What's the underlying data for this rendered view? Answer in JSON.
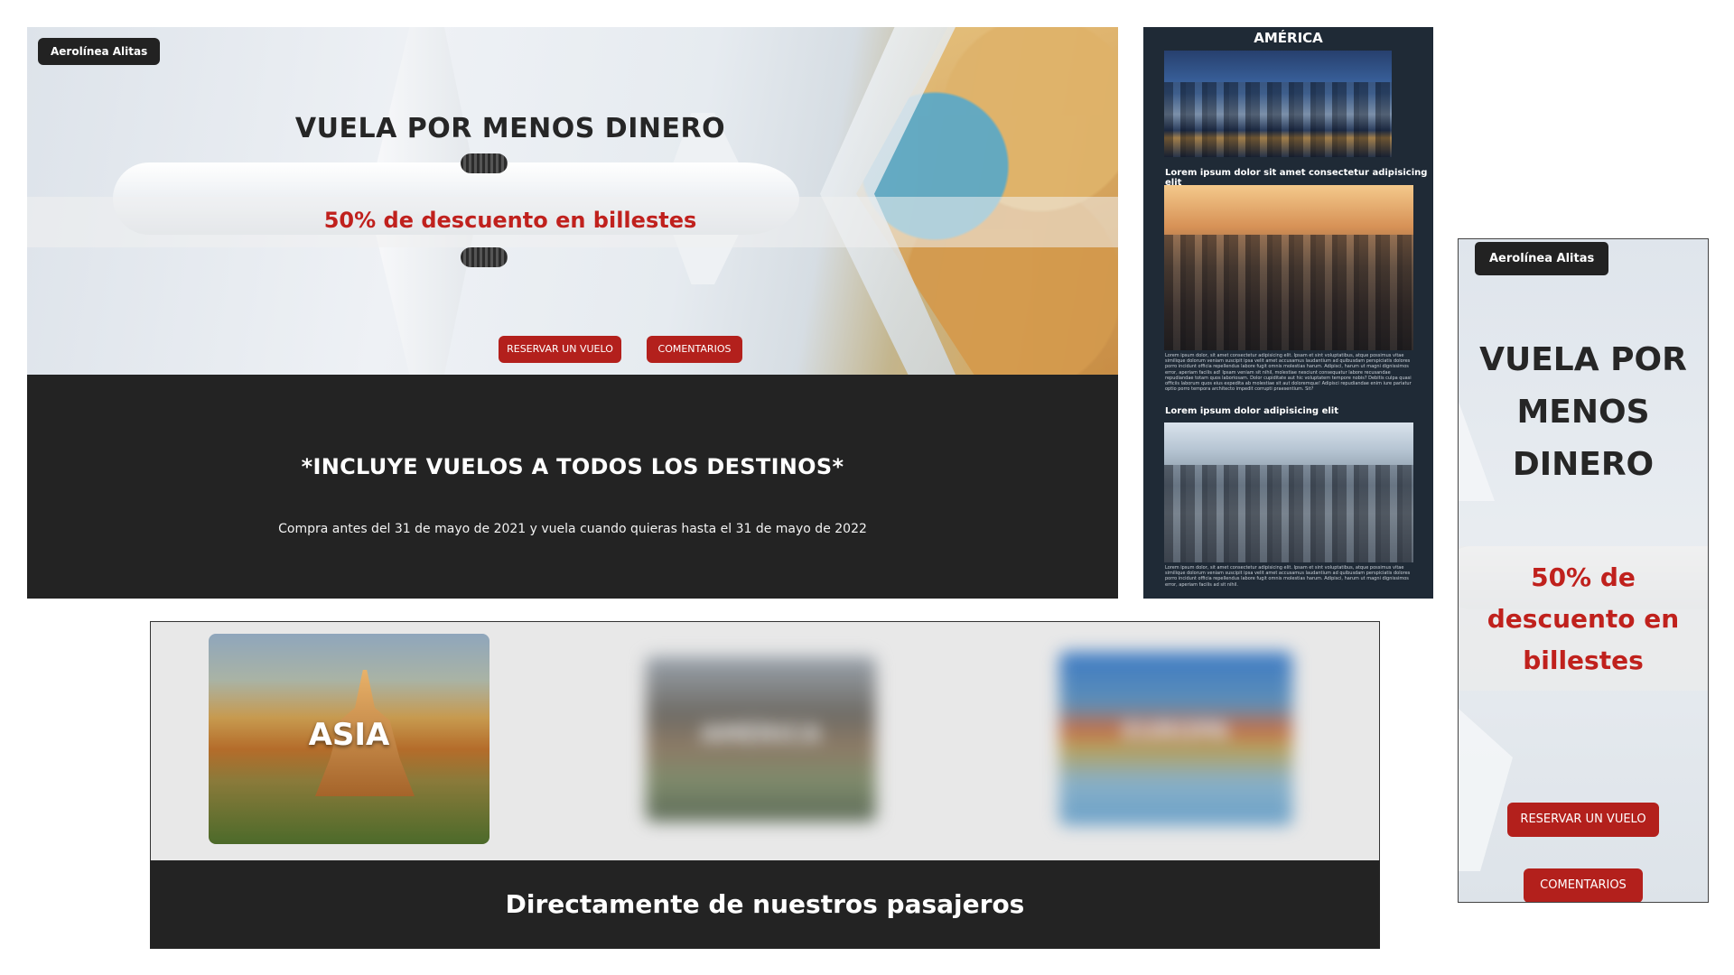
{
  "hero": {
    "brand": "Aerolínea Alitas",
    "title": "VUELA POR MENOS DINERO",
    "subtitle": "50% de descuento en billestes",
    "button_book": "RESERVAR UN VUELO",
    "button_comments": "COMENTARIOS"
  },
  "band": {
    "title": "*INCLUYE VUELOS A TODOS LOS DESTINOS*",
    "text": "Compra antes del 31 de mayo de 2021 y vuela cuando quieras hasta el 31 de mayo de 2022"
  },
  "america": {
    "title": "AMÉRICA",
    "heading1": "Lorem ipsum dolor sit amet consectetur adipisicing elit",
    "paragraph1": "Lorem ipsum dolor, sit amet consectetur adipisicing elit. Ipsam et sint voluptatibus, atque possimus vitae similique dolorum veniam suscipit ipsa velit amet accusamus laudantium ad quibusdam perspiciatis dolores porro incidunt officia repellendus labore fugit omnis molestias harum. Adipisci, harum ut magni dignissimos error, aperiam facilis ad! Ipsam veniam sit nihil, molestiae nesciunt consequatur labore recusandae repudiandae totam quos laboriosam. Dolor cupiditate aut hic voluptatem tempore nobis? Debitis culpa quasi officiis laborum quos eius expedita ab molestiae sit aut doloremque! Adipisci repudiandae enim iure pariatur optio porro tempora architecto impedit corrupti praesentium. Sit?",
    "heading2": "Lorem ipsum dolor adipisicing elit",
    "paragraph2": "Lorem ipsum dolor, sit amet consectetur adipisicing elit. Ipsam et sint voluptatibus, atque possimus vitae similique dolorum veniam suscipit ipsa velit amet accusamus laudantium ad quibusdam perspiciatis dolores porro incidunt officia repellendus labore fugit omnis molestias harum. Adipisci, harum ut magni dignissimos error, aperiam facilis ad sit nihil."
  },
  "destinations": {
    "cards": [
      {
        "label": "ASIA"
      },
      {
        "label": "AMÉRICA"
      },
      {
        "label": "EUROPA"
      }
    ]
  },
  "testimonials": {
    "title": "Directamente de nuestros pasajeros"
  },
  "mobile": {
    "brand": "Aerolínea Alitas",
    "title": "VUELA POR MENOS DINERO",
    "subtitle": "50% de descuento en billestes",
    "button_book": "RESERVAR UN VUELO",
    "button_comments": "COMENTARIOS"
  }
}
